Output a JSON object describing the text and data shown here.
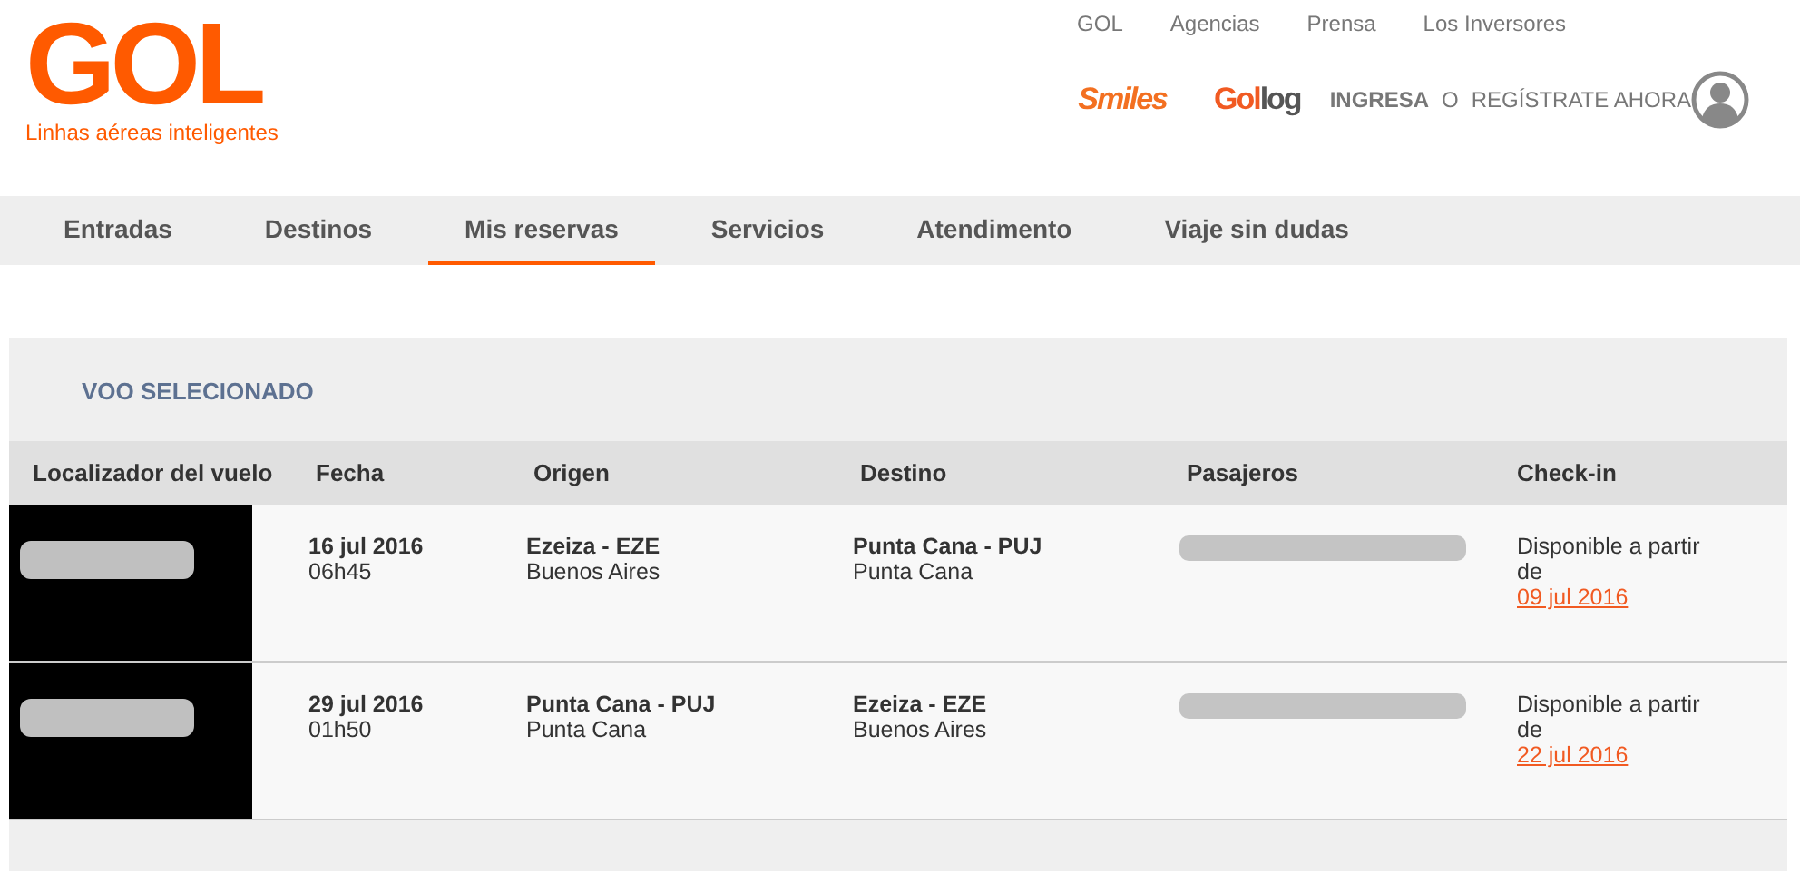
{
  "logo": {
    "name": "GOL",
    "tagline": "Linhas aéreas inteligentes"
  },
  "top_links": [
    "GOL",
    "Agencias",
    "Prensa",
    "Los Inversores"
  ],
  "partners": {
    "smiles": "Smiles",
    "gollog_a": "Gol",
    "gollog_b": "log"
  },
  "login": {
    "ingresa": "INGRESA",
    "or": "O",
    "register": "REGÍSTRATE AHORA"
  },
  "tabs": [
    {
      "label": "Entradas",
      "selected": false
    },
    {
      "label": "Destinos",
      "selected": false
    },
    {
      "label": "Mis reservas",
      "selected": true
    },
    {
      "label": "Servicios",
      "selected": false
    },
    {
      "label": "Atendimento",
      "selected": false
    },
    {
      "label": "Viaje sin dudas",
      "selected": false
    }
  ],
  "panel": {
    "title": "VOO SELECIONADO"
  },
  "table": {
    "columns": [
      "Localizador del vuelo",
      "Fecha",
      "Origen",
      "Destino",
      "Pasajeros",
      "Check-in"
    ],
    "rows": [
      {
        "date": "16 jul 2016",
        "time": "06h45",
        "origin": "Ezeiza - EZE",
        "origin_city": "Buenos Aires",
        "destination": "Punta Cana - PUJ",
        "destination_city": "Punta Cana",
        "checkin_text": "Disponible a partir de",
        "checkin_date": "09 jul 2016"
      },
      {
        "date": "29 jul 2016",
        "time": "01h50",
        "origin": "Punta Cana - PUJ",
        "origin_city": "Punta Cana",
        "destination": "Ezeiza - EZE",
        "destination_city": "Buenos Aires",
        "checkin_text": "Disponible a partir de",
        "checkin_date": "22 jul 2016"
      }
    ]
  }
}
